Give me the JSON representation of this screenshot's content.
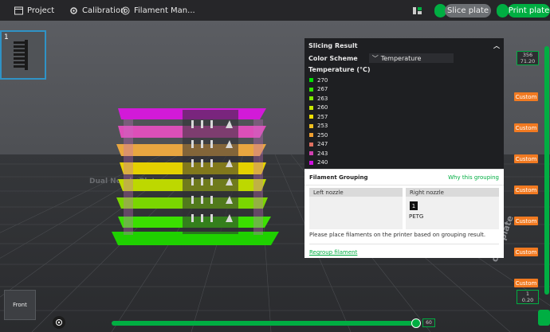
{
  "toolbar": {
    "project": "Project",
    "calibration": "Calibration",
    "filament_manager": "Filament Man...",
    "slice_plate": "Slice plate",
    "print_plate": "Print plate"
  },
  "thumbnail": {
    "index": "1"
  },
  "slicing_panel": {
    "title": "Slicing Result",
    "color_scheme_label": "Color Scheme",
    "color_scheme_value": "Temperature",
    "temperature_title": "Temperature (°C)",
    "legend": [
      {
        "label": "270",
        "color": "#00e000"
      },
      {
        "label": "267",
        "color": "#33e800"
      },
      {
        "label": "263",
        "color": "#80ea00"
      },
      {
        "label": "260",
        "color": "#c8ea00"
      },
      {
        "label": "257",
        "color": "#f0e000"
      },
      {
        "label": "253",
        "color": "#f0c020"
      },
      {
        "label": "250",
        "color": "#f0a030"
      },
      {
        "label": "247",
        "color": "#e07060"
      },
      {
        "label": "243",
        "color": "#d040b0"
      },
      {
        "label": "240",
        "color": "#d010e0"
      }
    ]
  },
  "filament_grouping": {
    "title": "Filament Grouping",
    "why_link": "Why this grouping",
    "left_nozzle": "Left nozzle",
    "right_nozzle": "Right nozzle",
    "chip_number": "1",
    "chip_material": "PETG",
    "note": "Please place filaments on the printer based on grouping result.",
    "regroup_link": "Regroup filament"
  },
  "layer_slider": {
    "top_value_line1": "356",
    "top_value_line2": "71.20",
    "bottom_value_line1": "1",
    "bottom_value_line2": "0.20",
    "custom_label": "Custom",
    "custom_count": 7
  },
  "move_slider": {
    "value": "60"
  },
  "view_cube": {
    "label": "Front"
  },
  "colors": {
    "accent": "#00ae42",
    "custom": "#f17a21"
  }
}
